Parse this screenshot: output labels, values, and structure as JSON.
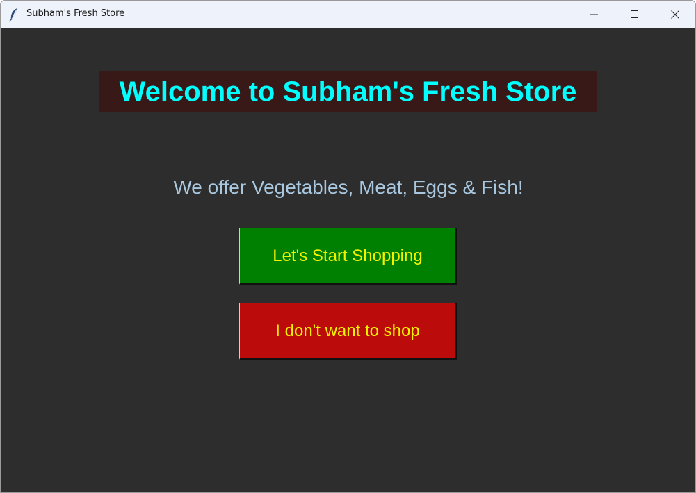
{
  "window": {
    "title": "Subham's Fresh Store",
    "app_icon": "feather-icon",
    "controls": {
      "minimize_icon": "minimize-icon",
      "maximize_icon": "maximize-icon",
      "close_icon": "close-icon"
    }
  },
  "main": {
    "heading": "Welcome to Subham's Fresh Store",
    "subtitle": "We offer Vegetables, Meat, Eggs & Fish!",
    "start_button_label": "Let's Start Shopping",
    "quit_button_label": "I don't want to shop"
  },
  "colors": {
    "background": "#2d2d2d",
    "heading_bg": "#391818",
    "heading_text": "#00ffff",
    "subtitle_text": "#a9c8e0",
    "start_button_bg": "#008000",
    "quit_button_bg": "#bc0b0b",
    "button_text": "#f3f300"
  }
}
